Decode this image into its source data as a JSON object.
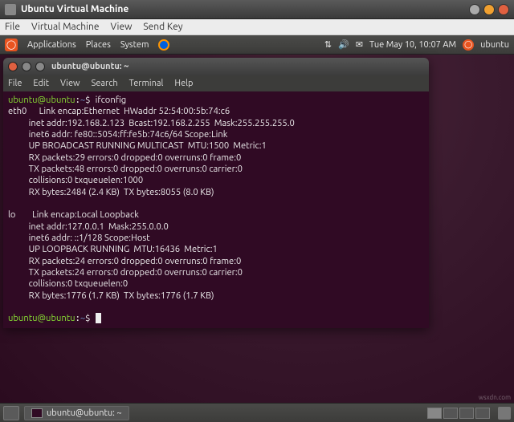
{
  "vm": {
    "title": "Ubuntu Virtual Machine",
    "menu": {
      "file": "File",
      "virtual_machine": "Virtual Machine",
      "view": "View",
      "send_key": "Send Key"
    }
  },
  "gnome_top": {
    "applications": "Applications",
    "places": "Places",
    "system": "System",
    "clock": "Tue May 10, 10:07 AM",
    "user": "ubuntu"
  },
  "terminal": {
    "title": "ubuntu@ubuntu: ~",
    "menu": {
      "file": "File",
      "edit": "Edit",
      "view": "View",
      "search": "Search",
      "terminal": "Terminal",
      "help": "Help"
    },
    "prompt_user": "ubuntu@ubuntu",
    "prompt_path": "~",
    "command": "ifconfig",
    "output": "eth0      Link encap:Ethernet  HWaddr 52:54:00:5b:74:c6\n          inet addr:192.168.2.123  Bcast:192.168.2.255  Mask:255.255.255.0\n          inet6 addr: fe80::5054:ff:fe5b:74c6/64 Scope:Link\n          UP BROADCAST RUNNING MULTICAST  MTU:1500  Metric:1\n          RX packets:29 errors:0 dropped:0 overruns:0 frame:0\n          TX packets:48 errors:0 dropped:0 overruns:0 carrier:0\n          collisions:0 txqueuelen:1000\n          RX bytes:2484 (2.4 KB)  TX bytes:8055 (8.0 KB)\n\nlo        Link encap:Local Loopback\n          inet addr:127.0.0.1  Mask:255.0.0.0\n          inet6 addr: ::1/128 Scope:Host\n          UP LOOPBACK RUNNING  MTU:16436  Metric:1\n          RX packets:24 errors:0 dropped:0 overruns:0 frame:0\n          TX packets:24 errors:0 dropped:0 overruns:0 carrier:0\n          collisions:0 txqueuelen:0\n          RX bytes:1776 (1.7 KB)  TX bytes:1776 (1.7 KB)\n"
  },
  "taskbar": {
    "item0": "ubuntu@ubuntu: ~"
  },
  "watermark": "wsxdn.com"
}
